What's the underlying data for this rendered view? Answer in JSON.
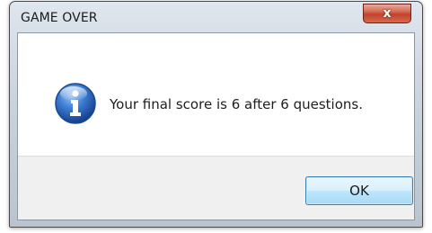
{
  "dialog": {
    "title": "GAME OVER",
    "close_glyph": "x",
    "message": "Your final score is 6 after 6 questions.",
    "icon": "info-icon",
    "ok_label": "OK"
  },
  "colors": {
    "icon_blue": "#2a63b8",
    "ok_border": "#3c7fb1",
    "close_red": "#c2422b"
  }
}
